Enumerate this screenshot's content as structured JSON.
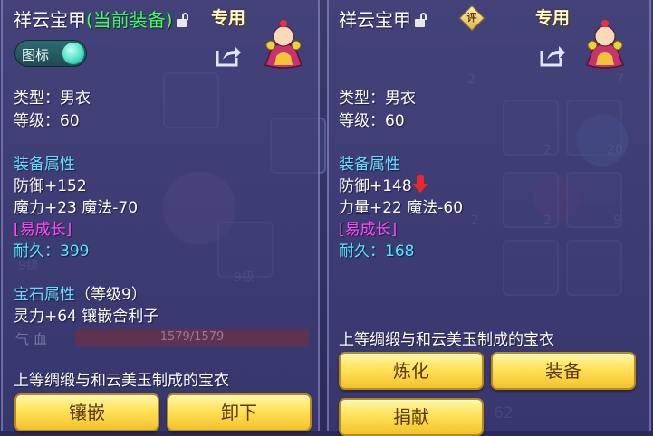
{
  "left": {
    "name": "祥云宝甲",
    "current_tag": "(当前装备)",
    "exclusive": "专用",
    "toggle_label": "图标",
    "type_line": "类型：男衣",
    "level_line": "等级：60",
    "attr_header": "装备属性",
    "stat1": "防御+152",
    "stat2": "魔力+23 魔法-70",
    "special": "[易成长]",
    "durability_label": "耐久：",
    "durability_value": "399",
    "gem_header": "宝石属性",
    "gem_level": "（等级9）",
    "gem_line": "灵力+64 镶嵌舍利子",
    "description": "上等绸缎与和云美玉制成的宝衣",
    "hp_label": "气 血",
    "hp_value": "1579/1579",
    "hp_fraction": 1.0,
    "buttons": {
      "inlay": "镶嵌",
      "unequip": "卸下"
    }
  },
  "right": {
    "name": "祥云宝甲",
    "rate_badge": "评",
    "exclusive": "专用",
    "type_line": "类型：男衣",
    "level_line": "等级：60",
    "attr_header": "装备属性",
    "stat1": "防御+148",
    "stat2": "力量+22 魔法-60",
    "special": "[易成长]",
    "durability_label": "耐久：",
    "durability_value": "168",
    "description": "上等绸缎与和云美玉制成的宝衣",
    "buttons": {
      "refine": "炼化",
      "equip": "装备",
      "donate": "捐献"
    }
  },
  "background_texts": [
    "9级",
    "9级",
    "2",
    "7",
    "2",
    "20",
    "2",
    "9",
    "2",
    "62"
  ],
  "colors": {
    "text": "#ffffff",
    "header": "#6ad8ff",
    "current_equipped": "#3dff5a",
    "special": "#ff4cf0",
    "durability": "#4fe8ff",
    "down_arrow": "#e8282a",
    "button_fill": "#ffe25a"
  }
}
